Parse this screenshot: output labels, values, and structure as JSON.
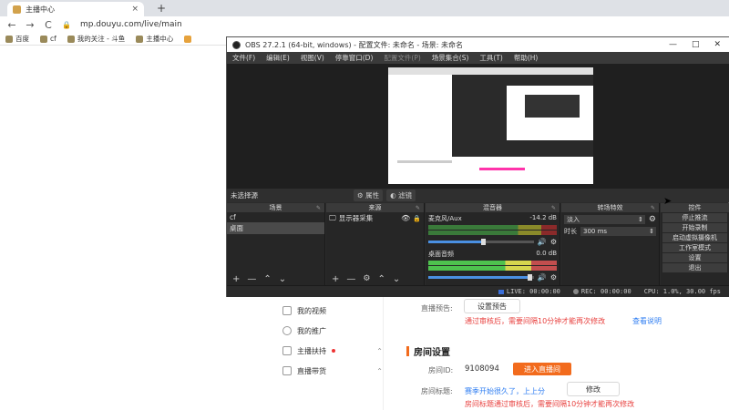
{
  "browser": {
    "tab_title": "主播中心",
    "tab_close": "×",
    "new_tab": "+",
    "back": "←",
    "forward": "→",
    "reload": "C",
    "url": "mp.douyu.com/live/main",
    "bookmarks": [
      "百度",
      "cf",
      "我的关注 - 斗鱼",
      "主播中心",
      "",
      "",
      "",
      ""
    ]
  },
  "page": {
    "left_menu": [
      {
        "label": "我的视频"
      },
      {
        "label": "我的推广"
      },
      {
        "label": "主播扶持"
      },
      {
        "label": "直播带货"
      }
    ],
    "preview_label": "直播预告:",
    "preview_button": "设置预告",
    "review_note": "通过审核后，需要间隔10分钟才能再次修改",
    "view_note": "查看说明",
    "section_title": "房间设置",
    "room_id_label": "房间ID:",
    "room_id": "9108094",
    "enter_room_button": "进入直播间",
    "room_title_label": "房间标题:",
    "room_title": "赛季开始很久了，上上分",
    "edit_button": "修改",
    "title_note": "房间标题通过审核后，需要间隔10分钟才能再次修改"
  },
  "obs": {
    "title": "OBS 27.2.1 (64-bit, windows) - 配置文件: 未命名 - 场景: 未命名",
    "window_controls": [
      "—",
      "□",
      "✕"
    ],
    "menu": [
      "文件(F)",
      "编辑(E)",
      "视图(V)",
      "停靠窗口(D)",
      "配置文件(P)",
      "场景集合(S)",
      "工具(T)",
      "帮助(H)"
    ],
    "scene_label": "未选择源",
    "properties_button": "属性",
    "filters_button": "滤镜",
    "docks": {
      "scenes": {
        "title": "场景",
        "items": [
          "cf",
          "桌面"
        ]
      },
      "sources": {
        "title": "来源",
        "items": [
          "显示器采集"
        ]
      },
      "mixer": {
        "title": "混音器",
        "channels": [
          {
            "name": "麦克风/Aux",
            "db": "-14.2 dB",
            "level": 0.7
          },
          {
            "name": "桌面音频",
            "db": "0.0 dB",
            "level": 1.0
          }
        ]
      },
      "transitions": {
        "title": "转场特效",
        "type": "淡入",
        "duration_label": "时长",
        "duration": "300 ms"
      },
      "controls": {
        "title": "控件",
        "buttons": [
          "停止推流",
          "开始录制",
          "启动虚拟摄像机",
          "工作室模式",
          "设置",
          "退出"
        ]
      }
    },
    "footer_icons": [
      "+",
      "—",
      "⌃",
      "⌄"
    ],
    "status": {
      "live": "LIVE: 00:00:00",
      "rec": "REC: 00:00:00",
      "cpu": "CPU: 1.0%, 30.00 fps"
    }
  },
  "colors": {
    "accent_orange": "#f26b1d",
    "warn_red": "#e8413f",
    "link_blue": "#2f7ef2"
  }
}
